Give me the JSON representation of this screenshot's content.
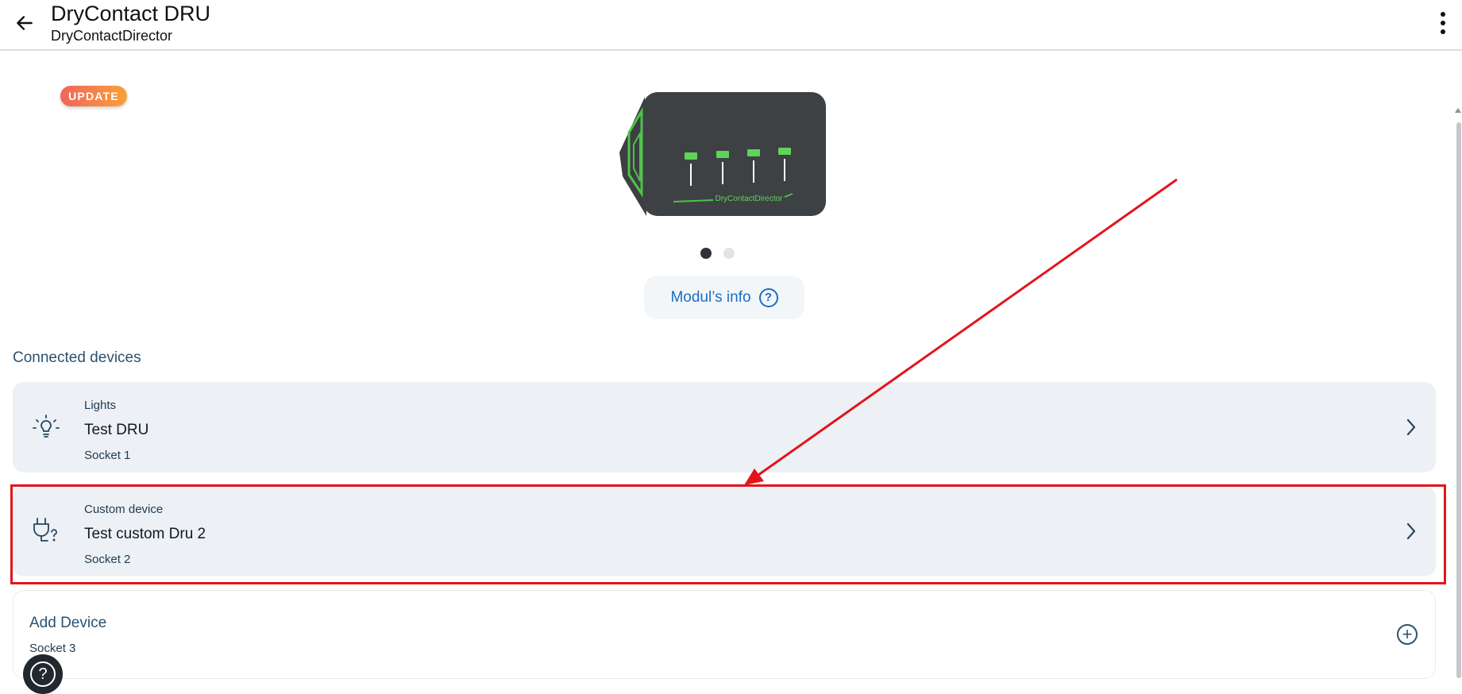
{
  "header": {
    "title": "DryContact DRU",
    "subtitle": "DryContactDirector"
  },
  "badge": {
    "label": "UPDATE"
  },
  "device_image": {
    "label": "DryContactDirector"
  },
  "carousel": {
    "count": 2,
    "active": 1
  },
  "info_button": {
    "label": "Modul’s info"
  },
  "section": {
    "title": "Connected devices"
  },
  "devices": [
    {
      "category": "Lights",
      "name": "Test DRU",
      "socket": "Socket 1",
      "icon": "lightbulb-icon"
    },
    {
      "category": "Custom device",
      "name": "Test custom Dru 2",
      "socket": "Socket 2",
      "icon": "plug-question-icon"
    }
  ],
  "add_device": {
    "label": "Add Device",
    "socket": "Socket 3"
  },
  "colors": {
    "accent": "#1a6fc4",
    "highlight": "#e3151b",
    "card_bg": "#edf0f4"
  }
}
